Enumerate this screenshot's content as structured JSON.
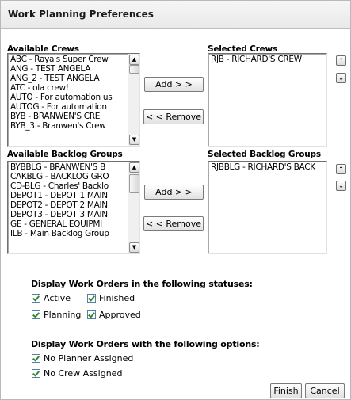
{
  "title": "Work Planning Preferences",
  "crews": {
    "available_label": "Available Crews",
    "selected_label": "Selected Crews",
    "available": [
      "ABC - Raya's Super Crew",
      "ANG - TEST ANGELA",
      "ANG_2 - TEST ANGELA",
      "ATC - ola crew!",
      "AUTO - For automation us",
      "AUTOG - For automation",
      "BYB - BRANWEN'S CRE",
      "BYB_3 - Branwen's Crew"
    ],
    "selected": [
      "RJB - RICHARD'S CREW"
    ],
    "add_label": "Add > >",
    "remove_label": "< < Remove"
  },
  "backlog": {
    "available_label": "Available Backlog Groups",
    "selected_label": "Selected Backlog Groups",
    "available": [
      "BYBBLG - BRANWEN'S B",
      "CAKBLG - BACKLOG GRO",
      "CD-BLG - Charles' Backlo",
      "DEPOT1 - DEPOT 1 MAIN",
      "DEPOT2 - DEPOT 2 MAIN",
      "DEPOT3 - DEPOT 3 MAIN",
      "GE - GENERAL EQUIPMI",
      "ILB - Main Backlog Group"
    ],
    "selected": [
      "RJBBLG - RICHARD'S BACK"
    ],
    "add_label": "Add > >",
    "remove_label": "< < Remove"
  },
  "statuses": {
    "heading": "Display Work Orders in the following statuses:",
    "active": "Active",
    "finished": "Finished",
    "planning": "Planning",
    "approved": "Approved"
  },
  "options": {
    "heading": "Display Work Orders with the following options:",
    "no_planner": "No Planner Assigned",
    "no_crew": "No Crew Assigned"
  },
  "footer": {
    "finish": "Finish",
    "cancel": "Cancel"
  }
}
